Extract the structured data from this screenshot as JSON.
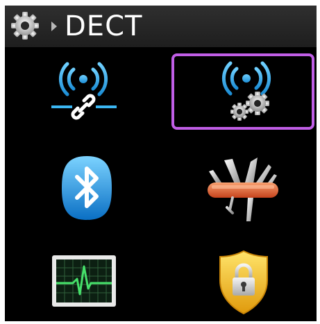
{
  "header": {
    "title": "DECT",
    "settings_icon": "gear-icon",
    "separator_icon": "chevron-right-icon"
  },
  "menu": {
    "items": [
      {
        "name": "dect-pairing",
        "icon": "wireless-link-icon"
      },
      {
        "name": "dect-settings",
        "icon": "wireless-settings-icon",
        "selected": true
      },
      {
        "name": "bluetooth",
        "icon": "bluetooth-icon"
      },
      {
        "name": "tools",
        "icon": "swiss-army-knife-icon"
      },
      {
        "name": "diagnostics",
        "icon": "heart-monitor-icon"
      },
      {
        "name": "security",
        "icon": "security-shield-lock-icon"
      }
    ]
  },
  "colors": {
    "background": "#000000",
    "titlebar": "#262626",
    "selection": "#c05ee6",
    "accent_blue": "#29a8e8"
  }
}
